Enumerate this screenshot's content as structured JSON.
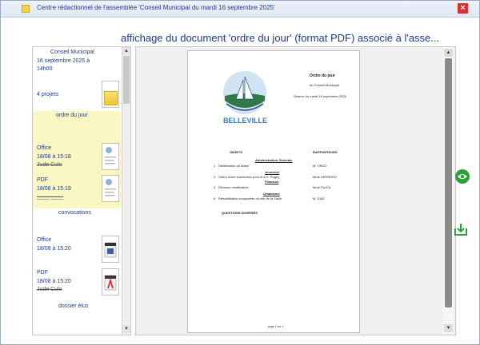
{
  "window": {
    "title": "Centre rédactionnel de l'assemblée 'Conseil Municipal du mardi 16 septembre 2025'",
    "close_label": "×"
  },
  "heading": "affichage du document 'ordre du jour' (format PDF) associé à l'asse...",
  "sidebar": {
    "meeting": {
      "name": "Conseil Municipal",
      "date_line1": "16 septembre 2025 à",
      "date_line2": "14h00",
      "projects": "4 projets"
    },
    "sections": [
      {
        "title": "ordre du jour",
        "files": [
          {
            "label": "Office",
            "date": "18/08 à 15:18",
            "author": "Jude Culo"
          },
          {
            "label": "PDF",
            "date": "18/08 à 15:19",
            "author": "____ ____"
          }
        ]
      },
      {
        "title": "convocations",
        "files": [
          {
            "label": "Office",
            "date": "18/08 à 15:20"
          },
          {
            "label": "PDF",
            "date": "18/08 à 15:20",
            "author": "Jude Culo"
          }
        ]
      },
      {
        "title": "dossier élus"
      }
    ],
    "scroll_up": "▲",
    "scroll_down": "▼"
  },
  "viewer": {
    "scroll_up": "▲",
    "scroll_down": "▼",
    "page": {
      "doc_title": "Ordre du jour",
      "doc_sub": "du Conseil Municipal",
      "doc_seance": "Séance du mardi 16 septembre 2025",
      "town": "BELLEVILLE",
      "col_objets": "OBJETS",
      "col_rapporteurs": "RAPPORTEURS",
      "cat1": "Administration Générale",
      "cat2": "Jeunesse",
      "cat3": "Finances",
      "cat4": "Urbanisme",
      "items": [
        {
          "num": "1",
          "text": "Délibération du Maire",
          "rapporteur": "M. ORDO"
        },
        {
          "num": "2",
          "text": "Octroi d'une subvention pour le A.S. Rugby",
          "rapporteur": "Mme HERRERO"
        },
        {
          "num": "3",
          "text": "Décision modificative",
          "rapporteur": "Mme PUJOL"
        },
        {
          "num": "4",
          "text": "Réhabilitation écoquartier du site de la Saule",
          "rapporteur": "M. DIAZ"
        }
      ],
      "questions": "QUESTIONS DIVERSES",
      "footer": "page 1 sur 1"
    }
  },
  "actions": {
    "view_icon": "eye-icon",
    "download_icon": "download-icon"
  },
  "colors": {
    "accent": "#1e3a8a",
    "highlight": "#fbf7c2",
    "close": "#d8302a",
    "action_green": "#2f9e3b"
  }
}
